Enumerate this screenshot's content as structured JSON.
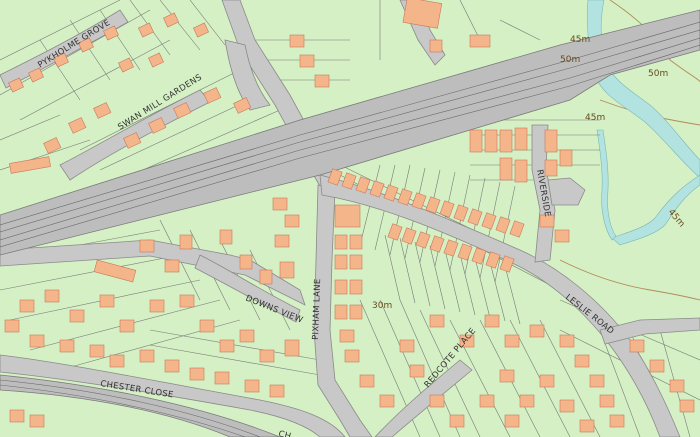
{
  "map": {
    "colors": {
      "land": "#d4f0c4",
      "building": "#f5b58a",
      "building_edge": "#c9785a",
      "road": "#c8c8c8",
      "road_edge": "#8a8a8a",
      "railway": "#bdbdbd",
      "water": "#b3e3e0",
      "contour": "#b48a5a",
      "plot_line": "#7a7a7a"
    },
    "road_labels": {
      "pykholme_grove": "PYKHOLME GROVE",
      "swan_mill_gardens": "SWAN MILL GARDENS",
      "riverside": "RIVERSIDE",
      "downs_view": "DOWNS VIEW",
      "pixham_lane": "PIXHAM LANE",
      "leslie_road": "LESLIE ROAD",
      "redcote_place": "REDCOTE PLACE",
      "chester_close": "CHESTER CLOSE",
      "ch": "CH"
    },
    "contour_labels": {
      "c45_top": "45m",
      "c50_left": "50m",
      "c50_right": "50m",
      "c45_mid": "45m",
      "c45_right": "45m",
      "c30": "30m"
    }
  }
}
